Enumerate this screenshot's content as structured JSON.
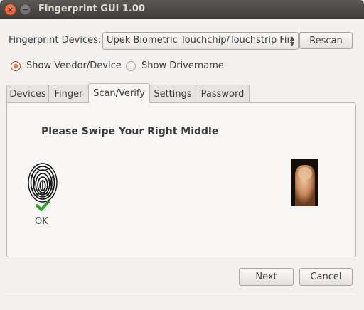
{
  "window": {
    "title": "Fingerprint GUI 1.00",
    "close_glyph": "×",
    "minimize_glyph": "−"
  },
  "devices": {
    "label": "Fingerprint Devices:",
    "selected": "Upek Biometric Touchchip/Touchstrip Fin",
    "rescan_label": "Rescan"
  },
  "display_mode": {
    "options": [
      {
        "label": "Show Vendor/Device",
        "checked": true
      },
      {
        "label": "Show Drivername",
        "checked": false
      }
    ]
  },
  "tabs": [
    {
      "label": "Devices",
      "active": false
    },
    {
      "label": "Finger",
      "active": false
    },
    {
      "label": "Scan/Verify",
      "active": true
    },
    {
      "label": "Settings",
      "active": false
    },
    {
      "label": "Password",
      "active": false
    }
  ],
  "scan": {
    "prompt": "Please Swipe Your Right Middle",
    "status": "OK"
  },
  "footer": {
    "next_label": "Next",
    "cancel_label": "Cancel"
  },
  "colors": {
    "accent": "#f07746",
    "check": "#2e9e2a",
    "title_bg": "#3d3c38"
  }
}
